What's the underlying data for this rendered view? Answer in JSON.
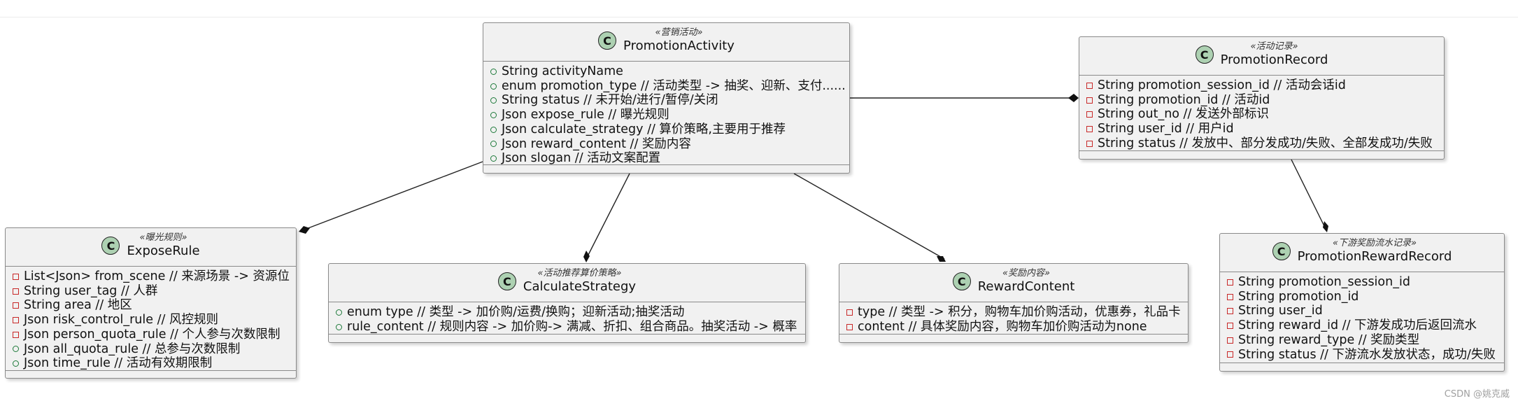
{
  "classes": {
    "promotion_activity": {
      "stereotype": "«营销活动»",
      "name": "PromotionActivity",
      "attrs": [
        {
          "vis": "public",
          "text": "String activityName"
        },
        {
          "vis": "public",
          "text": "enum promotion_type // 活动类型 -> 抽奖、迎新、支付......"
        },
        {
          "vis": "public",
          "text": "String status // 未开始/进行/暂停/关闭"
        },
        {
          "vis": "public",
          "text": "Json expose_rule // 曝光规则"
        },
        {
          "vis": "public",
          "text": "Json calculate_strategy // 算价策略,主要用于推荐"
        },
        {
          "vis": "public",
          "text": "Json reward_content // 奖励内容"
        },
        {
          "vis": "public",
          "text": "Json slogan // 活动文案配置"
        }
      ]
    },
    "promotion_record": {
      "stereotype": "«活动记录»",
      "name": "PromotionRecord",
      "attrs": [
        {
          "vis": "private",
          "text": "String promotion_session_id // 活动会话id"
        },
        {
          "vis": "private",
          "text": "String promotion_id // 活动id"
        },
        {
          "vis": "private",
          "text": "String out_no // 发送外部标识"
        },
        {
          "vis": "private",
          "text": "String user_id // 用户id"
        },
        {
          "vis": "private",
          "text": "String status // 发放中、部分发成功/失败、全部发成功/失败"
        }
      ]
    },
    "expose_rule": {
      "stereotype": "«曝光规则»",
      "name": "ExposeRule",
      "attrs": [
        {
          "vis": "private",
          "text": "List<Json> from_scene // 来源场景 -> 资源位"
        },
        {
          "vis": "private",
          "text": "String user_tag // 人群"
        },
        {
          "vis": "private",
          "text": "String area // 地区"
        },
        {
          "vis": "private",
          "text": "Json risk_control_rule // 风控规则"
        },
        {
          "vis": "private",
          "text": "Json person_quota_rule // 个人参与次数限制"
        },
        {
          "vis": "public",
          "text": "Json all_quota_rule // 总参与次数限制"
        },
        {
          "vis": "public",
          "text": "Json time_rule // 活动有效期限制"
        }
      ]
    },
    "calculate_strategy": {
      "stereotype": "«活动推荐算价策略»",
      "name": "CalculateStrategy",
      "attrs": [
        {
          "vis": "public",
          "text": "enum type // 类型 -> 加价购/运费/换购；迎新活动;抽奖活动"
        },
        {
          "vis": "public",
          "text": "rule_content // 规则内容 -> 加价购-> 满减、折扣、组合商品。抽奖活动 -> 概率"
        }
      ]
    },
    "reward_content": {
      "stereotype": "«奖励内容»",
      "name": "RewardContent",
      "attrs": [
        {
          "vis": "private",
          "text": "type // 类型 -> 积分，购物车加价购活动，优惠券，礼品卡"
        },
        {
          "vis": "private",
          "text": "content // 具体奖励内容，购物车加价购活动为none"
        }
      ]
    },
    "promotion_reward_record": {
      "stereotype": "«下游奖励流水记录»",
      "name": "PromotionRewardRecord",
      "attrs": [
        {
          "vis": "private",
          "text": "String promotion_session_id"
        },
        {
          "vis": "private",
          "text": "String promotion_id"
        },
        {
          "vis": "private",
          "text": "String user_id"
        },
        {
          "vis": "private",
          "text": "String reward_id // 下游发成功后返回流水"
        },
        {
          "vis": "private",
          "text": "String reward_type // 奖励类型"
        },
        {
          "vis": "private",
          "text": "String status // 下游流水发放状态，成功/失败"
        }
      ]
    }
  },
  "class_icon_letter": "C",
  "watermark": "CSDN @姚克威",
  "colors": {
    "class_fill": "#f1f1f1",
    "class_border": "#8a8a8a",
    "icon_fill": "#add1b2",
    "public_marker": "#1e7a3a",
    "private_marker": "#c82828",
    "link": "#222222"
  }
}
